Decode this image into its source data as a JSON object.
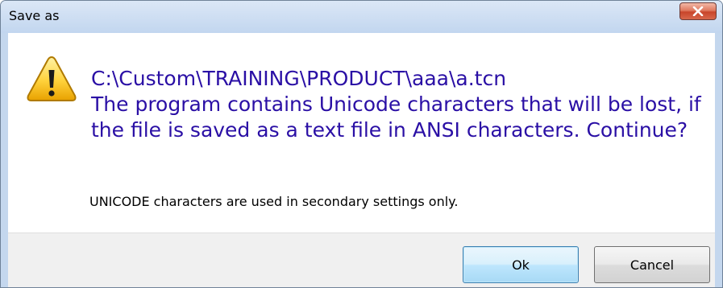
{
  "dialog": {
    "title": "Save as",
    "close_icon": "close-icon",
    "warning_icon": "warning-icon",
    "message": {
      "path": "C:\\Custom\\TRAINING\\PRODUCT\\aaa\\a.tcn",
      "text": "The program contains Unicode characters that will be lost, if the file is saved as a text file in ANSI characters. Continue?"
    },
    "secondary": "UNICODE characters are used in secondary settings only.",
    "buttons": {
      "ok_label": "Ok",
      "cancel_label": "Cancel"
    },
    "colors": {
      "message_text": "#2a0fa5",
      "close_button": "#c8452a",
      "frame": "#c4d7ee"
    }
  }
}
